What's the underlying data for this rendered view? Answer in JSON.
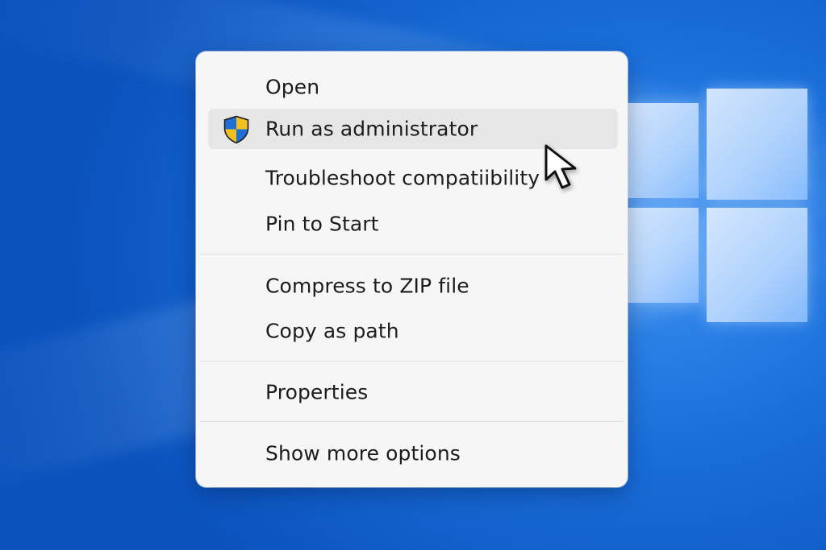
{
  "desktop": {
    "wallpaper": "windows-logo-wallpaper",
    "accent_color": "#1a6fdb"
  },
  "context_menu": {
    "items": [
      {
        "label": "Open"
      },
      {
        "label": "Run as administrator",
        "icon": "uac-shield-icon",
        "highlighted": true
      },
      {
        "label": "Troubleshoot compatiibility"
      },
      {
        "label": "Pin to Start"
      },
      {
        "label": "Compress to ZIP file"
      },
      {
        "label": "Copy as path"
      },
      {
        "label": "Properties"
      },
      {
        "label": "Show more options"
      }
    ]
  },
  "cursor": {
    "icon": "arrow-pointer-icon"
  }
}
